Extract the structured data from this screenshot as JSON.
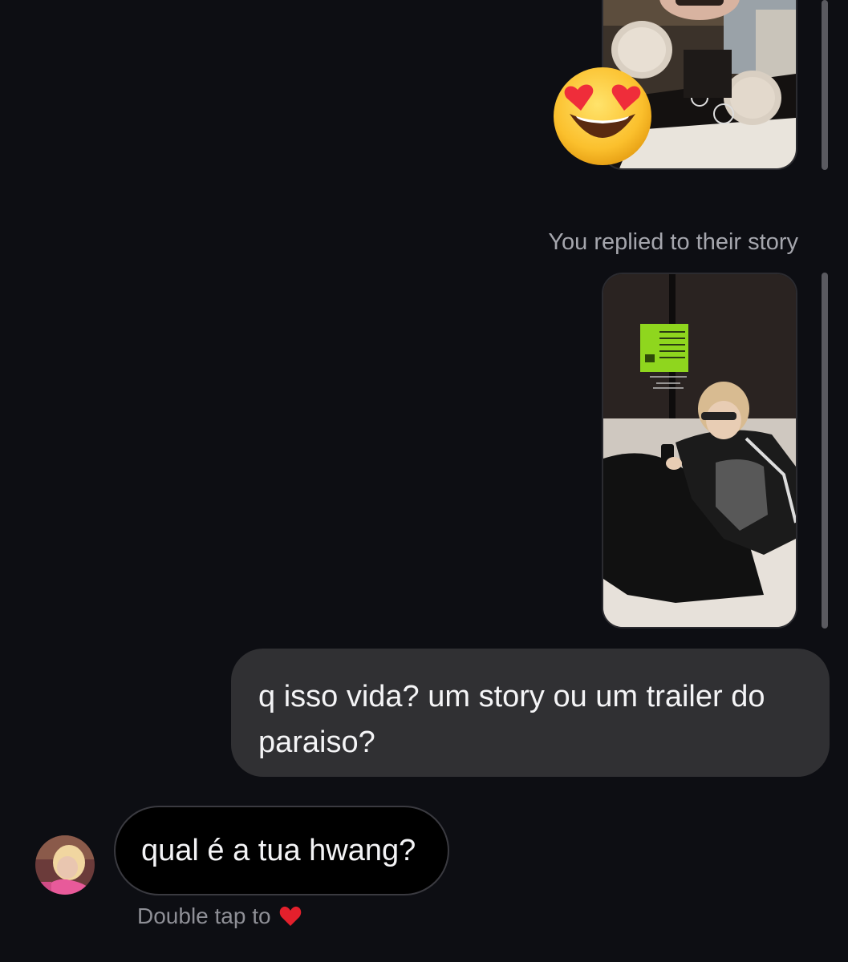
{
  "thread": {
    "reaction_emoji": "heart-eyes-emoji",
    "replied_label": "You replied to their story",
    "outgoing_message": "q isso vida? um story ou um trailer do paraiso?",
    "incoming_message": "qual é a tua hwang?",
    "double_tap_hint": "Double tap to",
    "hint_icon": "red-heart-icon"
  },
  "colors": {
    "background": "#0d0e13",
    "outgoing_bubble": "#303033",
    "incoming_bubble": "#000000",
    "heart": "#e3202c"
  }
}
